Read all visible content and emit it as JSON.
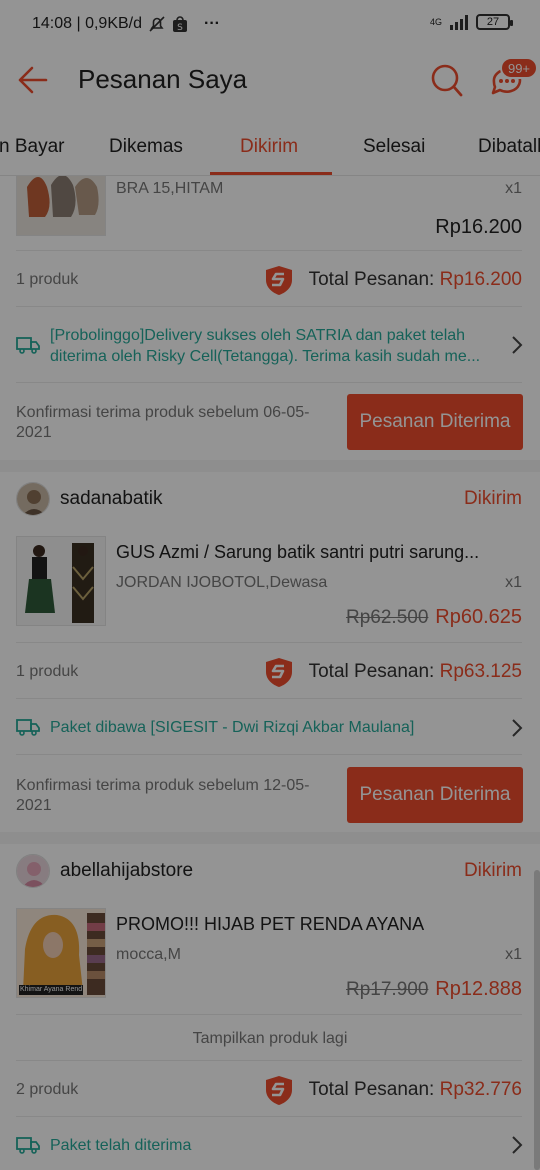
{
  "status_bar": {
    "time_info": "14:08 | 0,9KB/d",
    "more": "···",
    "network": "4G",
    "battery": "27",
    "icons": [
      "mute-bell-icon",
      "shopee-bag-icon",
      "signal-icon",
      "battery-icon"
    ]
  },
  "header": {
    "title": "Pesanan Saya",
    "chat_badge": "99+"
  },
  "tabs": [
    {
      "label": "n Bayar"
    },
    {
      "label": "Dikemas"
    },
    {
      "label": "Dikirim",
      "active": true
    },
    {
      "label": "Selesai"
    },
    {
      "label": "Dibatalk"
    }
  ],
  "orders": [
    {
      "variant": "BRA 15,HITAM",
      "qty": "x1",
      "price": "Rp16.200",
      "count": "1 produk",
      "total_label": "Total Pesanan:",
      "total": "Rp16.200",
      "shipping": "[Probolinggo]Delivery sukses oleh SATRIA dan paket telah diterima oleh Risky Cell(Tetangga). Terima kasih sudah me...",
      "confirm": "Konfirmasi terima produk sebelum 06-05-2021",
      "button": "Pesanan Diterima"
    },
    {
      "shop": "sadanabatik",
      "status": "Dikirim",
      "product": "GUS Azmi / Sarung batik santri putri sarung...",
      "variant": "JORDAN IJOBOTOL,Dewasa",
      "qty": "x1",
      "price_old": "Rp62.500",
      "price": "Rp60.625",
      "count": "1 produk",
      "total_label": "Total Pesanan:",
      "total": "Rp63.125",
      "shipping": "Paket dibawa [SIGESIT - Dwi Rizqi Akbar Maulana]",
      "confirm": "Konfirmasi terima produk sebelum 12-05-2021",
      "button": "Pesanan Diterima"
    },
    {
      "shop": "abellahijabstore",
      "status": "Dikirim",
      "product": "PROMO!!! HIJAB PET RENDA AYANA",
      "variant": "mocca,M",
      "qty": "x1",
      "price_old": "Rp17.900",
      "price": "Rp12.888",
      "thumb_caption": "Khimar Ayana Renda",
      "more": "Tampilkan produk lagi",
      "count": "2 produk",
      "total_label": "Total Pesanan:",
      "total": "Rp32.776",
      "shipping": "Paket telah diterima"
    }
  ],
  "colors": {
    "accent": "#ee4d2d",
    "teal": "#26aa99",
    "overlay": "rgba(0,0,0,0.42)"
  }
}
